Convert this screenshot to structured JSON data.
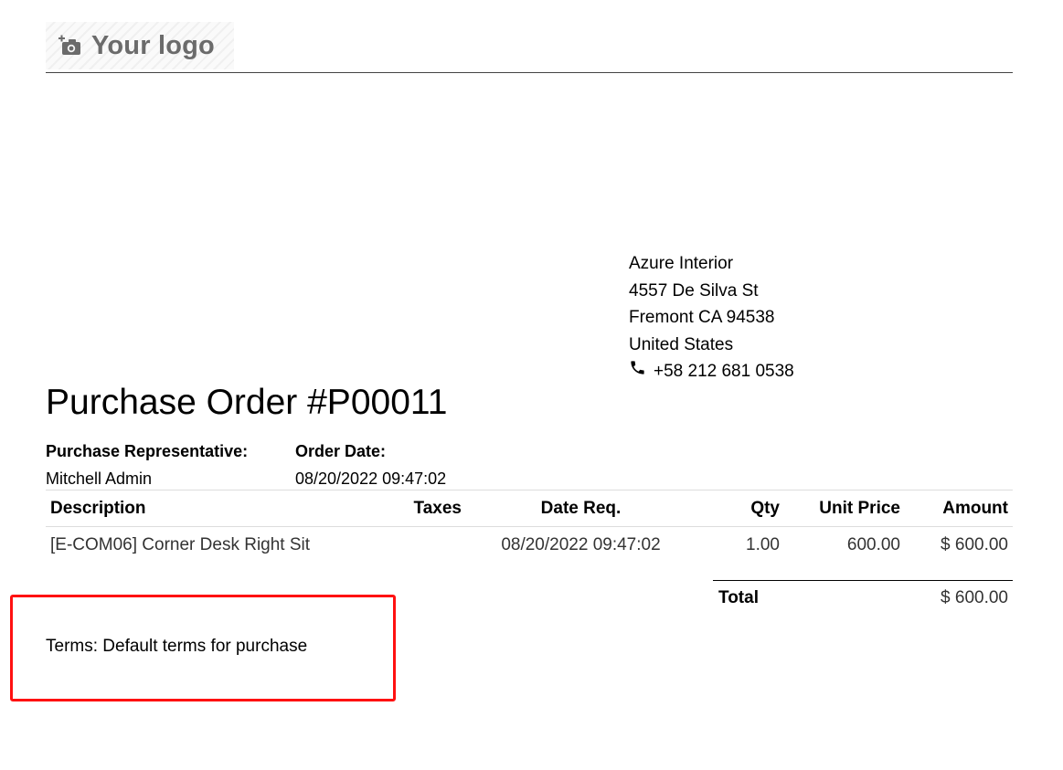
{
  "header": {
    "logo_text": "Your logo",
    "logo_icon": "add-photo-icon"
  },
  "vendor": {
    "name": "Azure Interior",
    "street": "4557 De Silva St",
    "city_line": "Fremont CA 94538",
    "country": "United States",
    "phone": "+58 212 681 0538",
    "phone_icon": "phone-icon"
  },
  "document": {
    "title": "Purchase Order #P00011"
  },
  "info": {
    "rep_label": "Purchase Representative:",
    "rep_value": "Mitchell Admin",
    "date_label": "Order Date:",
    "date_value": "08/20/2022 09:47:02"
  },
  "table": {
    "headers": {
      "description": "Description",
      "taxes": "Taxes",
      "date_req": "Date Req.",
      "qty": "Qty",
      "unit_price": "Unit Price",
      "amount": "Amount"
    },
    "rows": [
      {
        "description": "[E-COM06] Corner Desk Right Sit",
        "taxes": "",
        "date_req": "08/20/2022 09:47:02",
        "qty": "1.00",
        "unit_price": "600.00",
        "amount": "$ 600.00"
      }
    ]
  },
  "totals": {
    "label": "Total",
    "value": "$ 600.00"
  },
  "terms": {
    "text": "Terms: Default terms for purchase"
  },
  "colors": {
    "highlight_border": "#ff1111",
    "logo_text": "#6b6b6b"
  }
}
